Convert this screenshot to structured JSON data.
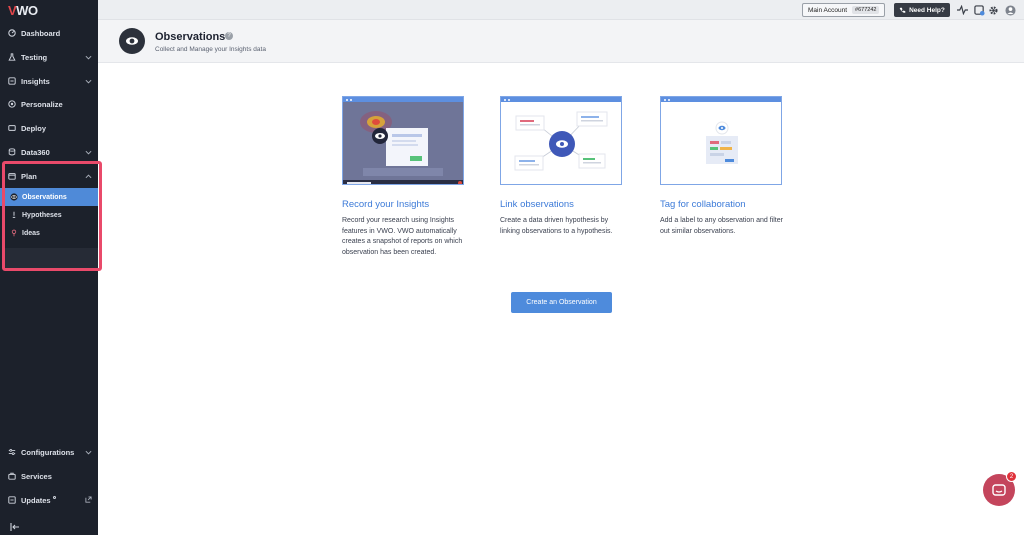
{
  "brand": {
    "logo_text": "VWO"
  },
  "topbar": {
    "account_label": "Main Account",
    "account_id": "#677242",
    "help_label": "Need Help?"
  },
  "sidebar": {
    "items": [
      {
        "label": "Dashboard",
        "icon": "dashboard-icon"
      },
      {
        "label": "Testing",
        "icon": "flask-icon"
      },
      {
        "label": "Insights",
        "icon": "insights-icon"
      },
      {
        "label": "Personalize",
        "icon": "target-icon"
      },
      {
        "label": "Deploy",
        "icon": "deploy-icon"
      },
      {
        "label": "Data360",
        "icon": "database-icon"
      },
      {
        "label": "Plan",
        "icon": "calendar-icon"
      }
    ],
    "plan_subitems": [
      {
        "label": "Observations",
        "icon": "eye-icon",
        "active": true
      },
      {
        "label": "Hypotheses",
        "icon": "bulb-icon",
        "active": false
      },
      {
        "label": "Ideas",
        "icon": "pin-icon",
        "active": false
      }
    ],
    "bottom_items": [
      {
        "label": "Configurations",
        "icon": "sliders-icon"
      },
      {
        "label": "Services",
        "icon": "briefcase-icon"
      },
      {
        "label": "Updates",
        "icon": "updates-icon"
      }
    ]
  },
  "header": {
    "title": "Observations",
    "subtitle": "Collect and Manage your Insights data"
  },
  "cards": [
    {
      "title": "Record your Insights",
      "description": "Record your research using Insights features in VWO. VWO automatically creates a snapshot of reports on which observation has been created."
    },
    {
      "title": "Link observations",
      "description": "Create a data driven hypothesis by linking observations to a hypothesis."
    },
    {
      "title": "Tag for collaboration",
      "description": "Add a label to any observation and filter out similar observations."
    }
  ],
  "cta_label": "Create an Observation",
  "chat": {
    "badge": "2"
  },
  "colors": {
    "accent": "#4e8bdc",
    "sidebar_bg": "#1c212b",
    "highlight": "#e94a6a"
  }
}
